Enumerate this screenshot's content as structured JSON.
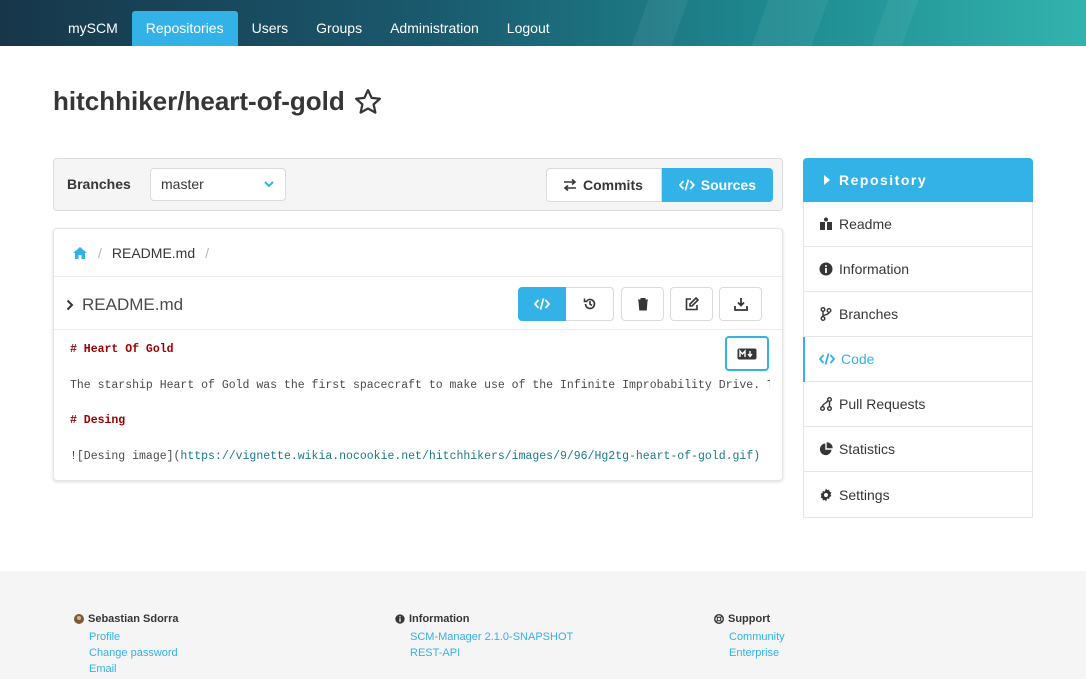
{
  "nav": {
    "items": [
      {
        "label": "mySCM"
      },
      {
        "label": "Repositories"
      },
      {
        "label": "Users"
      },
      {
        "label": "Groups"
      },
      {
        "label": "Administration"
      },
      {
        "label": "Logout"
      }
    ],
    "active": "Repositories"
  },
  "page": {
    "title": "hitchhiker/heart-of-gold"
  },
  "branchbar": {
    "label": "Branches",
    "selected": "master",
    "commits_label": "Commits",
    "sources_label": "Sources"
  },
  "source": {
    "breadcrumb_file": "README.md",
    "file_name": "README.md",
    "lines": [
      {
        "text": "# Heart Of Gold",
        "kind": "heading"
      },
      {
        "text": "The starship Heart of Gold was the first spacecraft to make use of the Infinite Improbability Drive. The craft was stolen by then-President Zaphod Beeblebrox",
        "kind": "text"
      },
      {
        "text": "# Desing",
        "kind": "heading"
      },
      {
        "prefix": "![Desing image](",
        "url": "https://vignette.wikia.nocookie.net/hitchhikers/images/9/96/Hg2tg-heart-of-gold.gif)",
        "kind": "link"
      }
    ]
  },
  "sidebar": {
    "header": "Repository",
    "items": [
      {
        "label": "Readme",
        "icon": "book-icon"
      },
      {
        "label": "Information",
        "icon": "info-icon"
      },
      {
        "label": "Branches",
        "icon": "branch-icon"
      },
      {
        "label": "Code",
        "icon": "code-icon"
      },
      {
        "label": "Pull Requests",
        "icon": "pull-request-icon"
      },
      {
        "label": "Statistics",
        "icon": "pie-chart-icon"
      },
      {
        "label": "Settings",
        "icon": "gear-icon"
      }
    ],
    "active": "Code"
  },
  "footer": {
    "user": {
      "name": "Sebastian Sdorra",
      "links": [
        "Profile",
        "Change password",
        "Email"
      ]
    },
    "information": {
      "title": "Information",
      "links": [
        "SCM-Manager 2.1.0-SNAPSHOT",
        "REST-API"
      ]
    },
    "support": {
      "title": "Support",
      "links": [
        "Community",
        "Enterprise"
      ]
    }
  },
  "colors": {
    "accent": "#33b2e8",
    "heading_code": "#990000",
    "nav_dark": "#17364a"
  }
}
